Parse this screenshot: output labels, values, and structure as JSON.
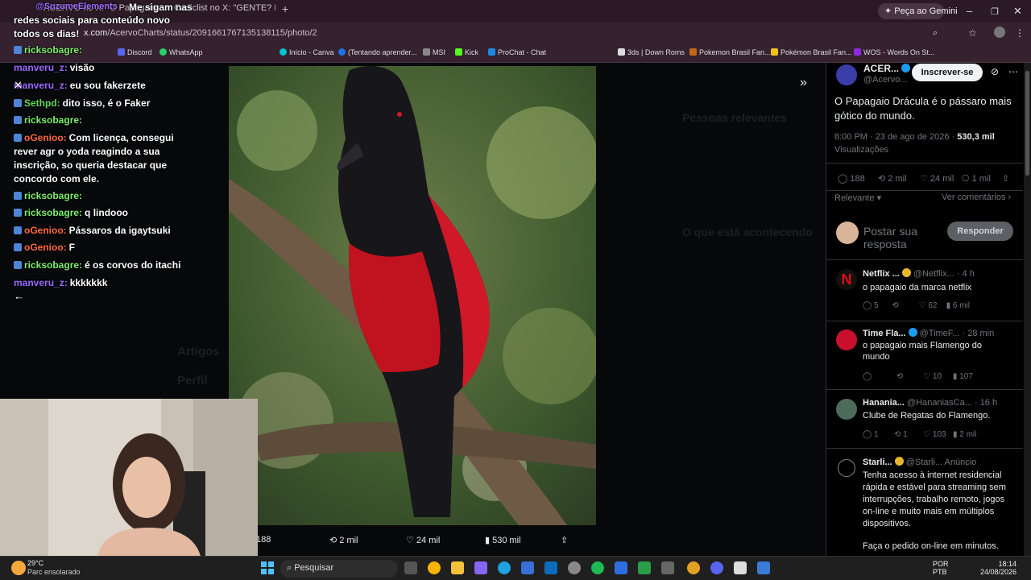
{
  "browser": {
    "tabs": [
      "ACERVO no X: \"O Papagaio D...",
      "Cadiclist no X: \"GENTE? Ricky A...",
      "+"
    ],
    "gemini": "Peça ao Gemini",
    "url_host": "x.com",
    "url_path": "/AcervoCharts/status/2091661767135138115/photo/2",
    "bookmarks": [
      "Discord",
      "WhatsApp",
      "Início - Canva",
      "(Tentando aprender...",
      "MSI",
      "Kick",
      "ProChat - Chat",
      "3ds | Down Roms",
      "Pokemon Brasil Fan...",
      "Pokémon Brasil Fan...",
      "WOS - Words On St..."
    ]
  },
  "overlay": {
    "pinned_user": "@SuzumeElements",
    "pinned_text": "Me sigam nas",
    "pinned_line2": "redes sociais para conteúdo novo",
    "pinned_line3": "todos os dias!"
  },
  "chat": [
    {
      "user": "ricksobagre:",
      "text": "",
      "color": "#7cf06b",
      "badge": true
    },
    {
      "user": "manveru_z:",
      "text": "visão",
      "color": "#9b6bff"
    },
    {
      "user": "manveru_z:",
      "text": "eu sou fakerzete",
      "color": "#9b6bff"
    },
    {
      "user": "Sethpd:",
      "text": "dito isso, é o Faker",
      "color": "#63d95b",
      "badge": "o"
    },
    {
      "user": "ricksobagre:",
      "text": "",
      "color": "#7cf06b",
      "badge": true
    },
    {
      "user": "oGenioo:",
      "text": "Com licença, consegui",
      "color": "#ff6a3d",
      "badge": true
    },
    {
      "user": "",
      "text": "rever agr o yoda reagindo a sua",
      "color": "#fff"
    },
    {
      "user": "",
      "text": "inscrição, so queria destacar que",
      "color": "#fff"
    },
    {
      "user": "",
      "text": "concordo com ele.",
      "color": "#fff"
    },
    {
      "user": "ricksobagre:",
      "text": "",
      "color": "#7cf06b",
      "badge": true
    },
    {
      "user": "ricksobagre:",
      "text": "q lindooo",
      "color": "#7cf06b",
      "badge": true
    },
    {
      "user": "oGenioo:",
      "text": "Pássaros da igaytsuki",
      "color": "#ff6a3d",
      "badge": true
    },
    {
      "user": "oGenioo:",
      "text": "F",
      "color": "#ff6a3d",
      "badge": true
    },
    {
      "user": "ricksobagre:",
      "text": "é os corvos do itachi",
      "color": "#7cf06b",
      "badge": true
    },
    {
      "user": "manveru_z:",
      "text": "kkkkkkk",
      "color": "#9b6bff"
    }
  ],
  "background_ghost": {
    "relevant": "Pessoas relevantes",
    "happening": "O que está acontecendo",
    "artigos": "Artigos",
    "perfil": "Perfil"
  },
  "post_actions": {
    "replies": "188",
    "reposts": "2 mil",
    "likes": "24 mil",
    "views": "530 mil"
  },
  "tweet": {
    "author": "ACER...",
    "handle": "@Acervo...",
    "subscribe": "Inscrever-se",
    "text_1": "O Papagaio Drácula é o pássaro mais",
    "text_2": "gótico do mundo.",
    "time": "8:00 PM · 23 de ago de 2026 · ",
    "views_num": "530,3 mil",
    "views_label": "Visualizações",
    "replies": "188",
    "reposts": "2 mil",
    "likes": "24 mil",
    "bookmarks": "1 mil",
    "relevant": "Relevante",
    "see_comments": "Ver comentários",
    "reply_placeholder_1": "Postar sua",
    "reply_placeholder_2": "resposta",
    "reply_button": "Responder"
  },
  "replies": [
    {
      "name": "Netflix ...",
      "handle": "@Netflix...",
      "time": "· 4 h",
      "text": [
        "o papagaio da marca netflix"
      ],
      "r": "5",
      "rt": "",
      "l": "62",
      "v": "6 mil"
    },
    {
      "name": "Time Fla...",
      "handle": "@TimeF...",
      "time": "· 28 min",
      "text": [
        "o papagaio mais Flamengo do",
        "mundo"
      ],
      "r": "",
      "rt": "",
      "l": "10",
      "v": "107"
    },
    {
      "name": "Hanania...",
      "handle": "@HananiasCa...",
      "time": "· 16 h",
      "text": [
        "Clube de Regatas do Flamengo."
      ],
      "r": "1",
      "rt": "1",
      "l": "103",
      "v": "2 mil"
    },
    {
      "name": "Starli...",
      "handle": "@Starli...",
      "time": "Anúncio",
      "text": [
        "Tenha acesso à internet residencial",
        "rápida e estável para streaming sem",
        "interrupções, trabalho remoto, jogos",
        "on-line e muito mais em múltiplos",
        "dispositivos."
      ],
      "cta": "Faça o pedido on-line em minutos."
    }
  ],
  "taskbar": {
    "temp": "29°C",
    "weather": "Parc ensolarado",
    "search": "Pesquisar",
    "lang": "POR",
    "kbd": "PTB",
    "time": "18:14",
    "date": "24/08/2026"
  },
  "colors": {
    "accent": "#1d9bf0",
    "bg": "#000000"
  }
}
